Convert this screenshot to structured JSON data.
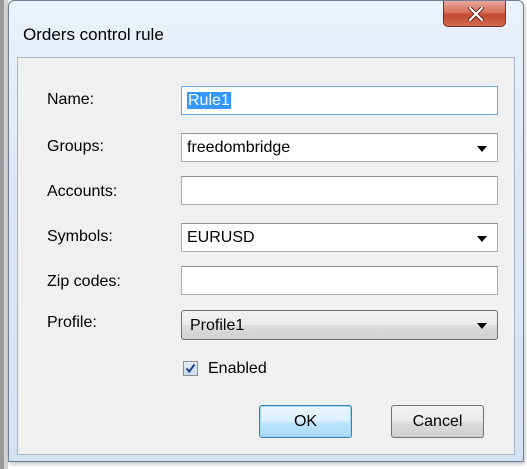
{
  "window": {
    "title": "Orders control rule"
  },
  "form": {
    "name_label": "Name:",
    "name_value": "Rule1",
    "groups_label": "Groups:",
    "groups_value": "freedombridge",
    "accounts_label": "Accounts:",
    "accounts_value": "",
    "symbols_label": "Symbols:",
    "symbols_value": "EURUSD",
    "zip_label": "Zip codes:",
    "zip_value": "",
    "profile_label": "Profile:",
    "profile_value": "Profile1",
    "enabled_label": "Enabled",
    "enabled_checked": true
  },
  "buttons": {
    "ok": "OK",
    "cancel": "Cancel"
  },
  "icons": {
    "close": "close-icon",
    "dropdown": "chevron-down-icon",
    "check": "checkmark-icon"
  },
  "colors": {
    "selection": "#3399ff",
    "close_button": "#c24a32"
  }
}
